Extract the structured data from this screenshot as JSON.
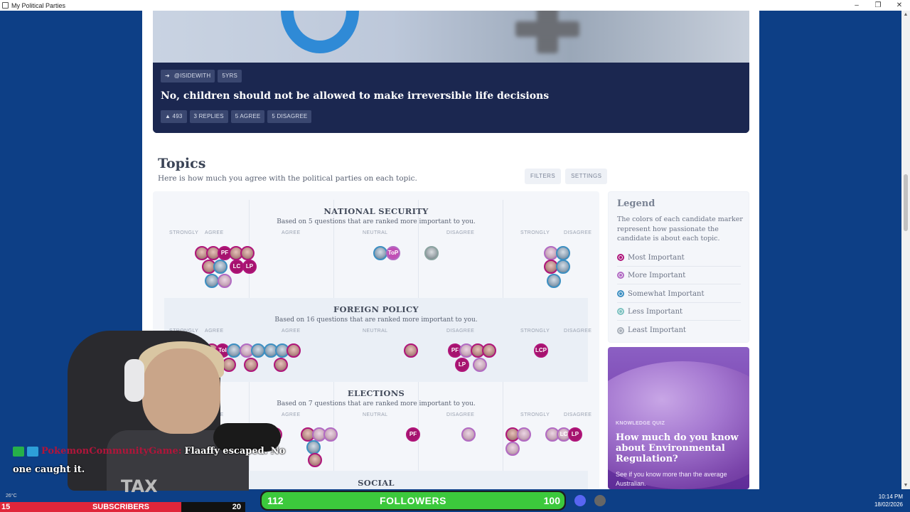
{
  "window": {
    "title": "My Political Parties",
    "controls": [
      "–",
      "❐",
      "✕"
    ]
  },
  "hero": {
    "source": "@ISIDEWITH",
    "age": "5YRS",
    "headline": "No, children should not be allowed to make irreversible life decisions",
    "stats": [
      "▲ 493",
      "3 REPLIES",
      "5 AGREE",
      "5 DISAGREE"
    ]
  },
  "topics": {
    "title": "Topics",
    "subtitle": "Here is how much you agree with the political parties on each topic.",
    "filters_label": "FILTERS",
    "settings_label": "SETTINGS",
    "scale_labels": [
      "STRONGLY",
      "AGREE",
      "AGREE",
      "NEUTRAL",
      "DISAGREE",
      "STRONGLY",
      "DISAGREE"
    ],
    "items": [
      {
        "name": "NATIONAL SECURITY",
        "basis": "Based on 5 questions that are ranked more important to you."
      },
      {
        "name": "FOREIGN POLICY",
        "basis": "Based on 16 questions that are ranked more important to you."
      },
      {
        "name": "ELECTIONS",
        "basis": "Based on 7 questions that are ranked more important to you."
      },
      {
        "name": "SOCIAL",
        "basis": ""
      }
    ],
    "marker_labels": {
      "pf": "PF",
      "lc": "LC",
      "lp": "LP",
      "top": "ToP",
      "lcp": "LCP",
      "tol": "ToI",
      "lcc": "LC"
    }
  },
  "legend": {
    "title": "Legend",
    "description": "The colors of each candidate marker represent how passionate the candidate is about each topic.",
    "items": [
      {
        "label": "Most Important",
        "color": "#b0157a"
      },
      {
        "label": "More Important",
        "color": "#b26ac3"
      },
      {
        "label": "Somewhat Important",
        "color": "#3c8fc2"
      },
      {
        "label": "Less Important",
        "color": "#7cc2c0"
      },
      {
        "label": "Least Important",
        "color": "#a9b0ba"
      }
    ]
  },
  "quiz": {
    "kicker": "KNOWLEDGE QUIZ",
    "title": "How much do you know about Environmental Regulation?",
    "description": "See if you know more than the average Australian."
  },
  "overlay": {
    "chat_user": "PokemonCommunityGame:",
    "chat_msg": "Flaaffy escaped. No",
    "chat_line2": "one caught it.",
    "shirt_logo": "TAX",
    "temperature": "26°C",
    "subscribers_label": "SUBSCRIBERS",
    "subscribers_left": "15",
    "subscribers_right": "20",
    "followers_label": "FOLLOWERS",
    "followers_current": "112",
    "followers_goal": "100",
    "clock_time": "10:14 PM",
    "clock_date": "18/02/2026"
  }
}
